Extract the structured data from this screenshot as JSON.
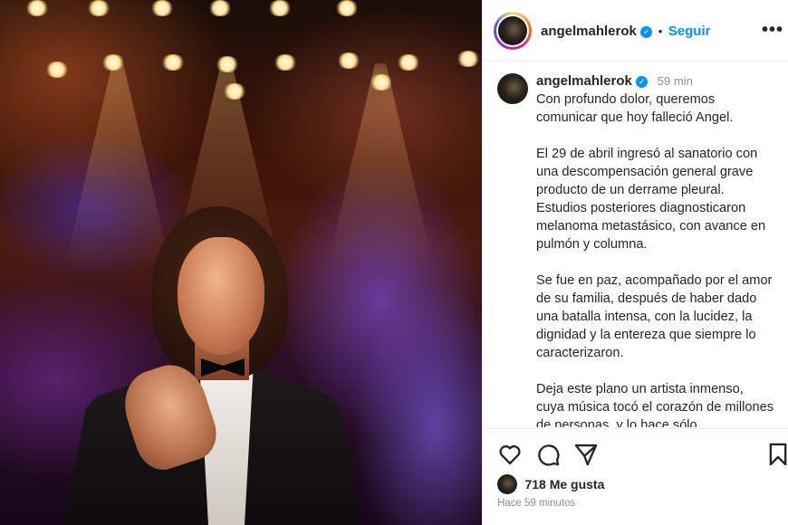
{
  "post": {
    "username": "angelmahlerok",
    "follow_label": "Seguir",
    "separator": "•",
    "more_label": "•••",
    "caption_time": "59 min",
    "caption_paragraphs": [
      "Con profundo dolor, queremos comunicar que hoy falleció Angel.",
      "El 29 de abril ingresó al sanatorio con una descompensación general grave producto de un derrame pleural. Estudios posteriores diagnosticaron melanoma metastásico, con avance en pulmón y columna.",
      "Se fue en paz, acompañado por el amor de su familia, después de haber dado una batalla intensa, con la lucidez, la dignidad y la entereza que siempre lo caracterizaron.",
      "Deja este plano un artista inmenso, cuya música tocó el corazón de millones de personas, y lo hace sólo"
    ],
    "likes_text": "718 Me gusta",
    "posted_ago": "Hace 59 minutos"
  },
  "icons": {
    "verified": "verified-badge-icon",
    "like": "heart-icon",
    "comment": "comment-bubble-icon",
    "share": "paper-plane-icon",
    "save": "bookmark-icon",
    "more": "more-options-icon"
  },
  "colors": {
    "link_blue": "#0095f6",
    "text": "#262626",
    "muted": "#8e8e8e",
    "border": "#efefef"
  }
}
